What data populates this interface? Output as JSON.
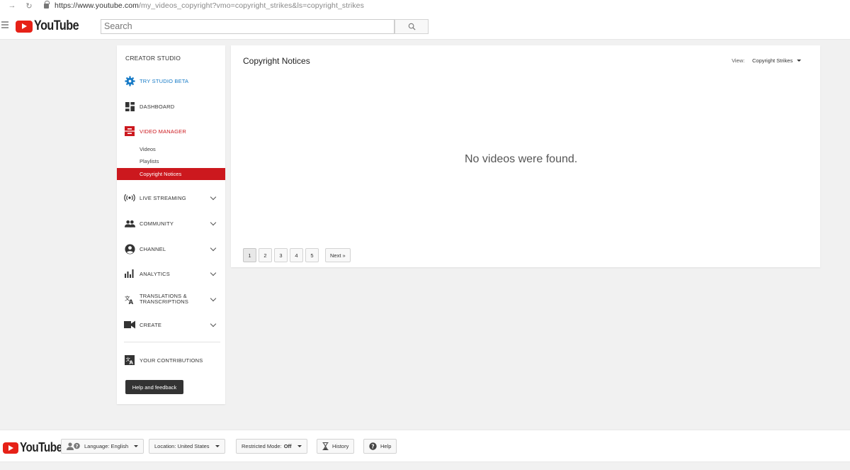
{
  "browser": {
    "url_host": "https://www.youtube.com",
    "url_rest": "/my_videos_copyright?vmo=copyright_strikes&ls=copyright_strikes"
  },
  "masthead": {
    "logo_text": "YouTube",
    "search_placeholder": "Search"
  },
  "sidebar": {
    "heading": "CREATOR STUDIO",
    "items": {
      "try_beta": "TRY STUDIO BETA",
      "dashboard": "DASHBOARD",
      "video_manager": "VIDEO MANAGER",
      "live_streaming": "LIVE STREAMING",
      "community": "COMMUNITY",
      "channel": "CHANNEL",
      "analytics": "ANALYTICS",
      "translations_1": "TRANSLATIONS &",
      "translations_2": "TRANSCRIPTIONS",
      "create": "CREATE",
      "contributions": "YOUR CONTRIBUTIONS"
    },
    "sub_items": {
      "videos": "Videos",
      "playlists": "Playlists",
      "copyright_notices": "Copyright Notices"
    },
    "help_button": "Help and feedback"
  },
  "main": {
    "title": "Copyright Notices",
    "view_label": "View:",
    "view_value": "Copyright Strikes",
    "empty_message": "No videos were found.",
    "pages": [
      "1",
      "2",
      "3",
      "4",
      "5"
    ],
    "next_label": "Next »"
  },
  "footer": {
    "logo_text": "YouTube",
    "language": "Language: English",
    "location": "Location: United States",
    "restricted_label": "Restricted Mode:",
    "restricted_value": "Off",
    "history": "History",
    "help": "Help"
  },
  "colors": {
    "brand_red": "#e62117",
    "active_red": "#cc181e",
    "link_blue": "#167ac6"
  }
}
